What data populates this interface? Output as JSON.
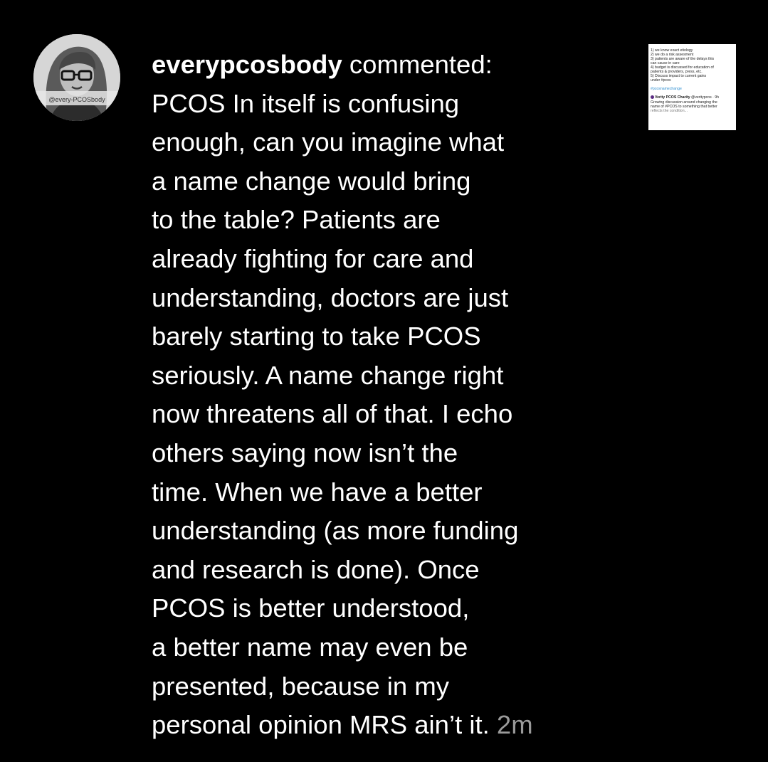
{
  "profile": {
    "username": "everypcosbody",
    "avatar_watermark": "@every-PCOSbody"
  },
  "comment": {
    "action": " commented:",
    "lines": [
      "PCOS In itself is confusing",
      "enough, can you imagine what",
      "a name change would bring",
      "to the table? Patients are",
      "already fighting for care and",
      "understanding, doctors are just",
      "barely starting to take PCOS",
      "seriously. A name change right",
      "now threatens all of that. I echo",
      "others saying now isn’t the",
      "time. When we have a better",
      "understanding (as more funding",
      "and research is done). Once",
      "PCOS is better understood,",
      "a better name may even be",
      "presented, because in my",
      "personal opinion MRS ain’t it."
    ],
    "timestamp": "2m"
  },
  "post_thumbnail": {
    "lines": [
      "1) we know exact etiology",
      "2) we do a risk assesment",
      "3) patients are aware of the delays this",
      "can cause in care",
      "4) budget is discussed for education of",
      "patients & providers, press, etc.",
      "5) Discuss impact to current gains",
      "under #pcos"
    ],
    "hashtag": "#pcosnamechange",
    "author": "Verity PCOS Charity",
    "author_meta": "@veritypcos · 9h",
    "reply_lines": [
      "Growing discussion around changing the",
      "name of #PCOS to something that better",
      "reflects the condition..."
    ]
  },
  "colors": {
    "background": "#000000",
    "text": "#ffffff",
    "timestamp": "#9a9a9a",
    "hashtag": "#2f8fd1"
  }
}
